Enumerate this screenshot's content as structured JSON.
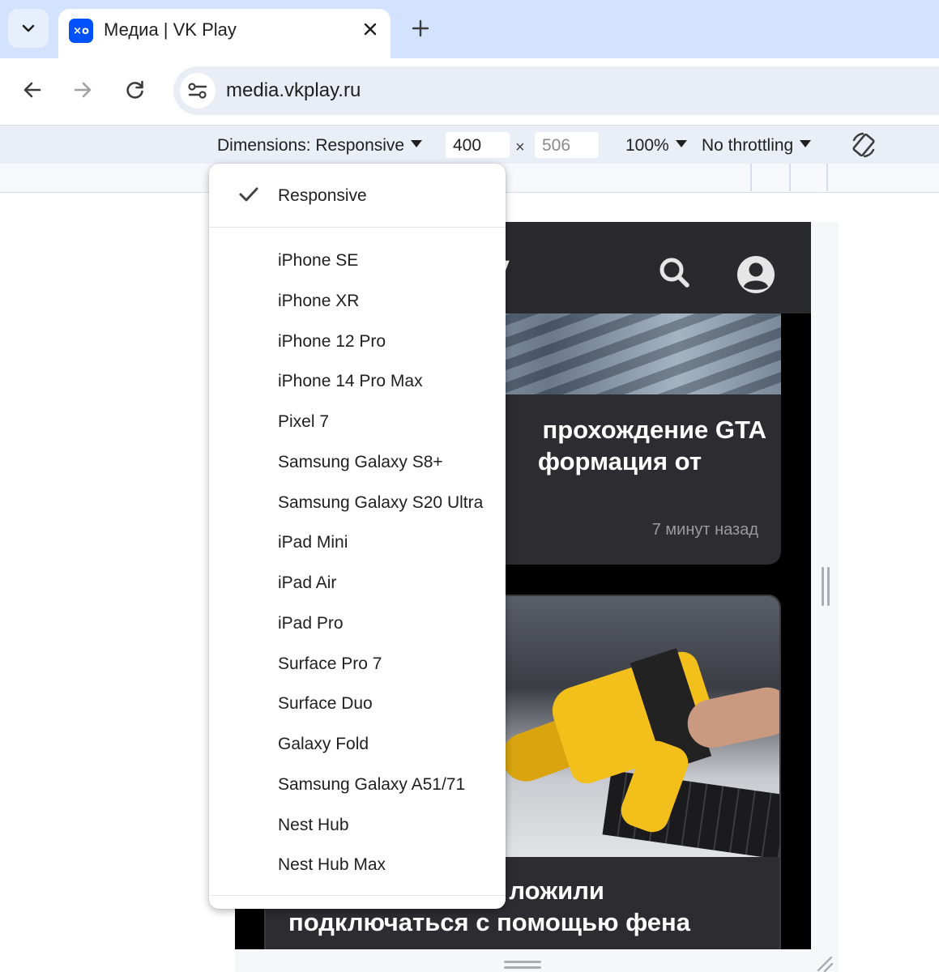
{
  "browser": {
    "tab": {
      "title": "Медиа | VK Play",
      "favicon_text": "×o"
    },
    "url": "media.vkplay.ru"
  },
  "devtools": {
    "dimensions_label": "Dimensions: Responsive",
    "width_value": "400",
    "height_placeholder": "506",
    "times": "×",
    "zoom": "100%",
    "throttling": "No throttling"
  },
  "menu": {
    "selected": "Responsive",
    "items": [
      "iPhone SE",
      "iPhone XR",
      "iPhone 12 Pro",
      "iPhone 14 Pro Max",
      "Pixel 7",
      "Samsung Galaxy S8+",
      "Samsung Galaxy S20 Ultra",
      "iPad Mini",
      "iPad Air",
      "iPad Pro",
      "Surface Pro 7",
      "Surface Duo",
      "Galaxy Fold",
      "Samsung Galaxy A51/71",
      "Nest Hub",
      "Nest Hub Max"
    ]
  },
  "page": {
    "logo_fragment": "y",
    "card1": {
      "title_line1": "прохождение GTA",
      "title_line2": "формация от",
      "time": "7 минут назад"
    },
    "card2": {
      "title_line1": "ложили",
      "title_line2": "подключаться с помощью фена"
    }
  },
  "icons": {
    "tab_search": "chevron-down-icon",
    "tab_close": "close-icon",
    "new_tab": "plus-icon",
    "back": "arrow-left-icon",
    "forward": "arrow-right-icon",
    "reload": "reload-icon",
    "site_info": "tune-icon",
    "rotate": "rotate-icon",
    "check": "check-icon",
    "site_search": "search-icon",
    "site_user": "user-icon"
  },
  "colors": {
    "tabstrip": "#d3e3fd",
    "omnibox": "#e9eef6",
    "devbar": "#e9eef7",
    "site_header": "#29292e",
    "favicon": "#0052ff"
  }
}
